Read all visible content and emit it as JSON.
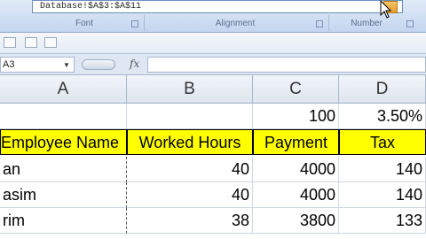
{
  "ribbon": {
    "tooltip_text": "Database!$A$3:$A$11",
    "groups": [
      "Font",
      "Alignment",
      "Number"
    ]
  },
  "formula_bar": {
    "name_box": "A3",
    "fx": "fx",
    "formula": ""
  },
  "columns": [
    "A",
    "B",
    "C",
    "D"
  ],
  "sheet": {
    "top_row": [
      "",
      "",
      "100",
      "3.50%"
    ],
    "headers": [
      "Employee Name",
      "Worked Hours",
      "Payment",
      "Tax"
    ],
    "rows": [
      [
        "an",
        "40",
        "4000",
        "140"
      ],
      [
        "asim",
        "40",
        "4000",
        "140"
      ],
      [
        "rim",
        "38",
        "3800",
        "133"
      ]
    ]
  }
}
